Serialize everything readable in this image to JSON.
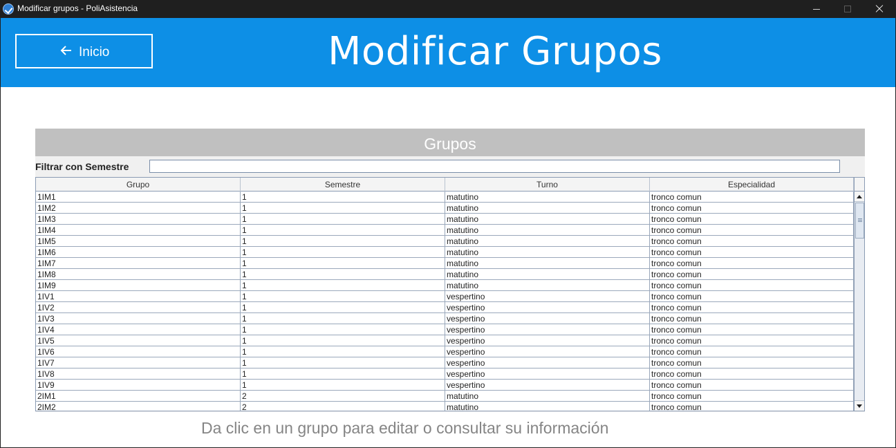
{
  "window": {
    "title": "Modificar grupos - PoliAsistencia"
  },
  "header": {
    "back_label": "Inicio",
    "title": "Modificar Grupos",
    "background": "#0d8fe6"
  },
  "panel": {
    "title": "Grupos",
    "filter_label": "Filtrar con Semestre",
    "filter_value": ""
  },
  "table": {
    "columns": [
      "Grupo",
      "Semestre",
      "Turno",
      "Especialidad"
    ],
    "rows": [
      [
        "1IM1",
        "1",
        "matutino",
        "tronco comun"
      ],
      [
        "1IM2",
        "1",
        "matutino",
        "tronco comun"
      ],
      [
        "1IM3",
        "1",
        "matutino",
        "tronco comun"
      ],
      [
        "1IM4",
        "1",
        "matutino",
        "tronco comun"
      ],
      [
        "1IM5",
        "1",
        "matutino",
        "tronco comun"
      ],
      [
        "1IM6",
        "1",
        "matutino",
        "tronco comun"
      ],
      [
        "1IM7",
        "1",
        "matutino",
        "tronco comun"
      ],
      [
        "1IM8",
        "1",
        "matutino",
        "tronco comun"
      ],
      [
        "1IM9",
        "1",
        "matutino",
        "tronco comun"
      ],
      [
        "1IV1",
        "1",
        "vespertino",
        "tronco comun"
      ],
      [
        "1IV2",
        "1",
        "vespertino",
        "tronco comun"
      ],
      [
        "1IV3",
        "1",
        "vespertino",
        "tronco comun"
      ],
      [
        "1IV4",
        "1",
        "vespertino",
        "tronco comun"
      ],
      [
        "1IV5",
        "1",
        "vespertino",
        "tronco comun"
      ],
      [
        "1IV6",
        "1",
        "vespertino",
        "tronco comun"
      ],
      [
        "1IV7",
        "1",
        "vespertino",
        "tronco comun"
      ],
      [
        "1IV8",
        "1",
        "vespertino",
        "tronco comun"
      ],
      [
        "1IV9",
        "1",
        "vespertino",
        "tronco comun"
      ],
      [
        "2IM1",
        "2",
        "matutino",
        "tronco comun"
      ],
      [
        "2IM2",
        "2",
        "matutino",
        "tronco comun"
      ]
    ]
  },
  "hint": "Da clic en un grupo para editar o consultar su información",
  "icons": {
    "app": "check-shield-icon",
    "back": "arrow-left-icon",
    "minimize": "minimize-icon",
    "maximize": "maximize-icon",
    "close": "close-icon",
    "scroll_up": "scroll-up-arrow-icon",
    "scroll_down": "scroll-down-arrow-icon"
  }
}
